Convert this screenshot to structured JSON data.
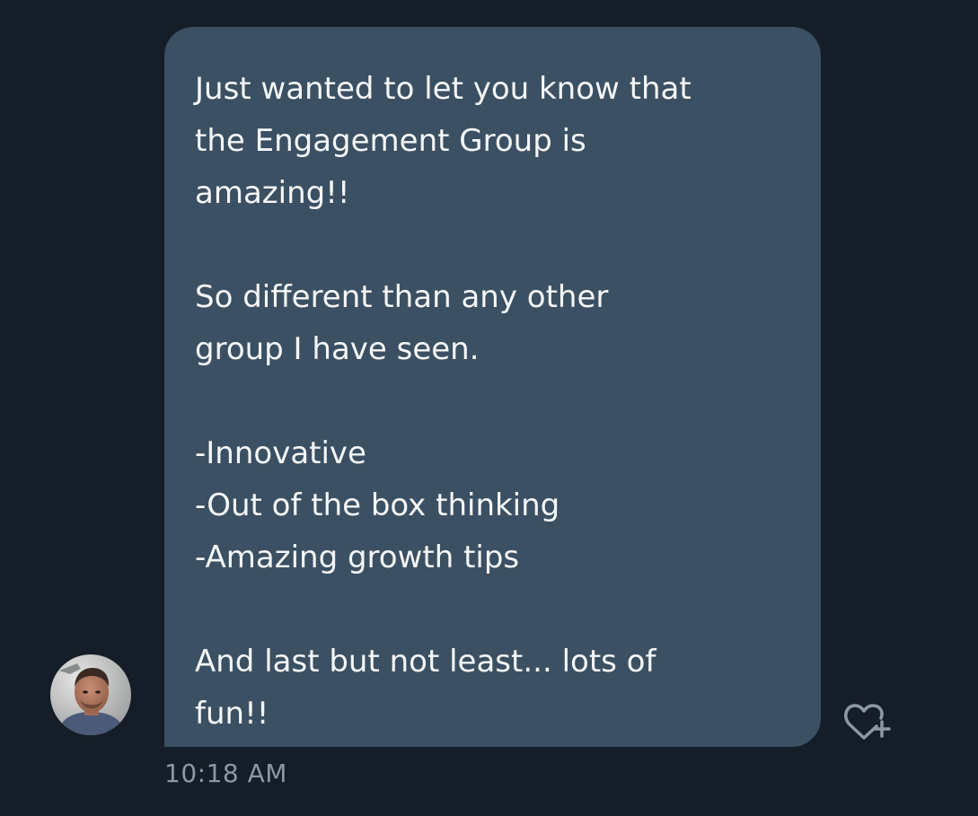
{
  "message": {
    "paragraphs": [
      "Just wanted to let you know that\nthe Engagement Group is\namazing!!",
      "So different than any other\ngroup I have seen.",
      "-Innovative\n-Out of the box thinking\n-Amazing growth tips",
      "And last but not least... lots of\nfun!!"
    ],
    "timestamp": "10:18 AM"
  },
  "sender": {
    "avatar_icon": "avatar-photo"
  },
  "actions": {
    "react_icon": "heart-plus-icon"
  },
  "colors": {
    "background": "#151d28",
    "bubble": "#3b5062",
    "message_text": "#f4f6f8",
    "timestamp_text": "#8b98a5"
  }
}
